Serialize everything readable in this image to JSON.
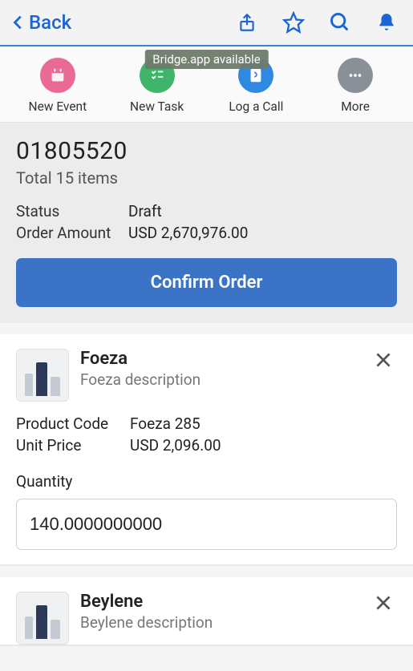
{
  "top": {
    "back_label": "Back"
  },
  "tooltip": "Bridge.app available",
  "actions": {
    "new_event": "New Event",
    "new_task": "New Task",
    "log_a_call": "Log a Call",
    "more": "More"
  },
  "summary": {
    "order_number": "01805520",
    "total_items": "Total 15 items",
    "status_label": "Status",
    "status_value": "Draft",
    "amount_label": "Order Amount",
    "amount_value": "USD 2,670,976.00",
    "confirm_label": "Confirm Order"
  },
  "items": [
    {
      "title": "Foeza",
      "description": "Foeza description",
      "product_code_label": "Product Code",
      "product_code_value": "Foeza 285",
      "unit_price_label": "Unit Price",
      "unit_price_value": "USD 2,096.00",
      "quantity_label": "Quantity",
      "quantity_value": "140.0000000000"
    },
    {
      "title": "Beylene",
      "description": "Beylene description"
    }
  ]
}
